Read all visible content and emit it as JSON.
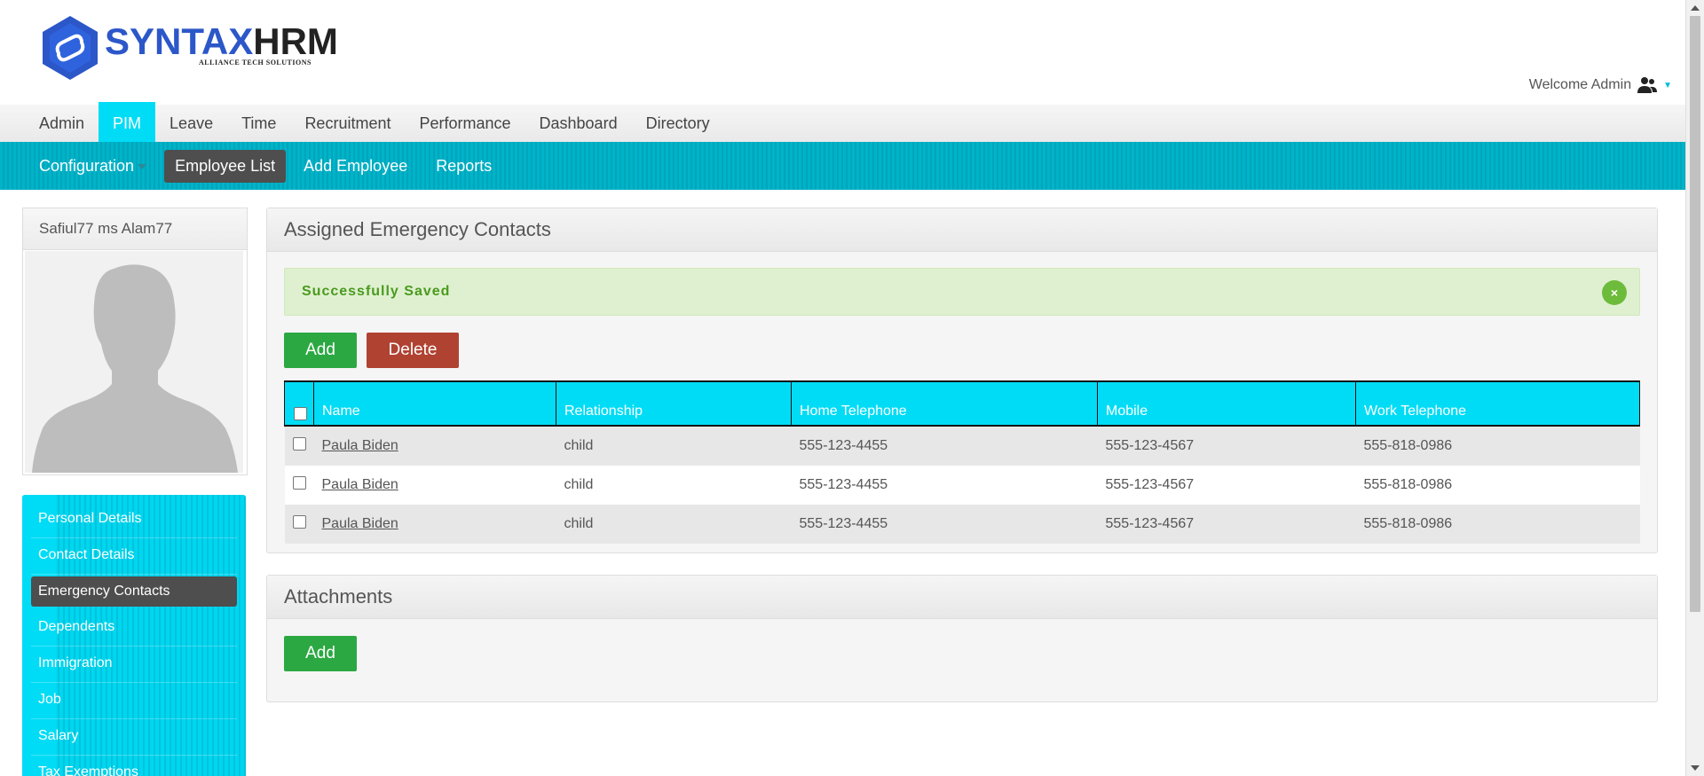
{
  "brand": {
    "logo_main": "SYNTAX",
    "logo_accent": "HRM",
    "logo_sub": "ALLIANCE TECH SOLUTIONS"
  },
  "header": {
    "welcome": "Welcome Admin"
  },
  "main_nav": [
    "Admin",
    "PIM",
    "Leave",
    "Time",
    "Recruitment",
    "Performance",
    "Dashboard",
    "Directory"
  ],
  "main_nav_active": "PIM",
  "sub_nav": [
    "Configuration",
    "Employee List",
    "Add Employee",
    "Reports"
  ],
  "sub_nav_active": "Employee List",
  "profile": {
    "name": "Safiul77 ms Alam77"
  },
  "side_menu": [
    "Personal Details",
    "Contact Details",
    "Emergency Contacts",
    "Dependents",
    "Immigration",
    "Job",
    "Salary",
    "Tax Exemptions"
  ],
  "side_menu_active": "Emergency Contacts",
  "emergency": {
    "title": "Assigned Emergency Contacts",
    "alert": "Successfully Saved",
    "alert_close": "×",
    "add_label": "Add",
    "delete_label": "Delete",
    "columns": [
      "Name",
      "Relationship",
      "Home Telephone",
      "Mobile",
      "Work Telephone"
    ],
    "rows": [
      {
        "name": "Paula Biden",
        "relationship": "child",
        "home": "555-123-4455",
        "mobile": "555-123-4567",
        "work": "555-818-0986"
      },
      {
        "name": "Paula Biden",
        "relationship": "child",
        "home": "555-123-4455",
        "mobile": "555-123-4567",
        "work": "555-818-0986"
      },
      {
        "name": "Paula Biden",
        "relationship": "child",
        "home": "555-123-4455",
        "mobile": "555-123-4567",
        "work": "555-818-0986"
      }
    ]
  },
  "attachments": {
    "title": "Attachments",
    "add_label": "Add"
  },
  "colors": {
    "accent": "#00dcf6",
    "subnav": "#00b3c9",
    "add_button": "#2ca843",
    "delete_button": "#b04232",
    "success_bg": "#dff0d0",
    "success_text": "#4a9a1e"
  }
}
